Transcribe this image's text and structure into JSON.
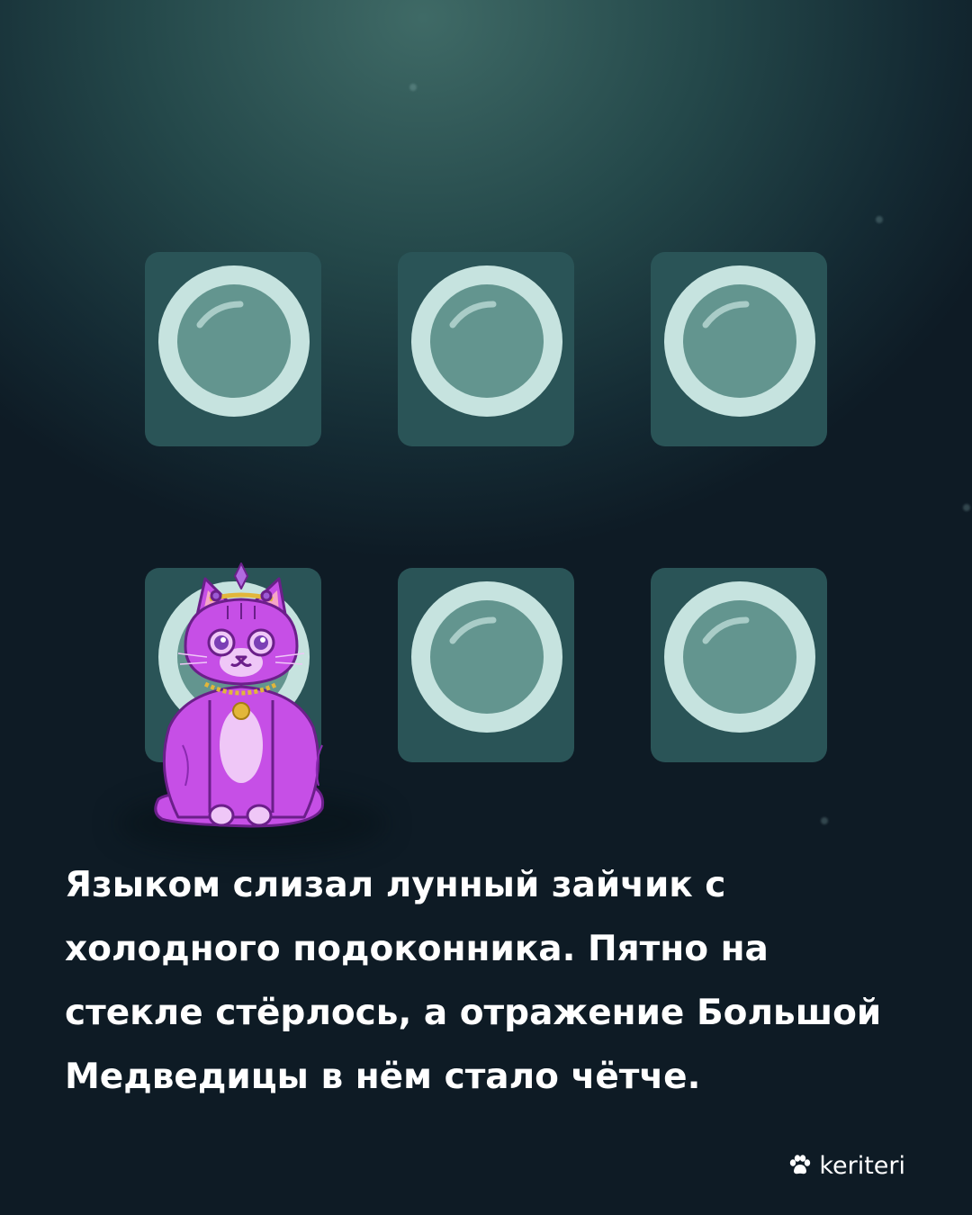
{
  "caption": {
    "line1": "Языком слизал лунный зайчик с",
    "line2": "холодного подоконника. Пятно на",
    "line3": "стекле стёрлось, а отражение Большой",
    "line4": "Медведицы в нём стало чётче."
  },
  "brand": {
    "name": "keriteri",
    "icon": "paw-icon"
  },
  "colors": {
    "background": "#1c3a3e",
    "tile": "#2a5457",
    "bubble_ring": "#c6e3df",
    "bubble_fill": "#63958f",
    "cat": "#c64fe6",
    "text": "#ffffff"
  }
}
